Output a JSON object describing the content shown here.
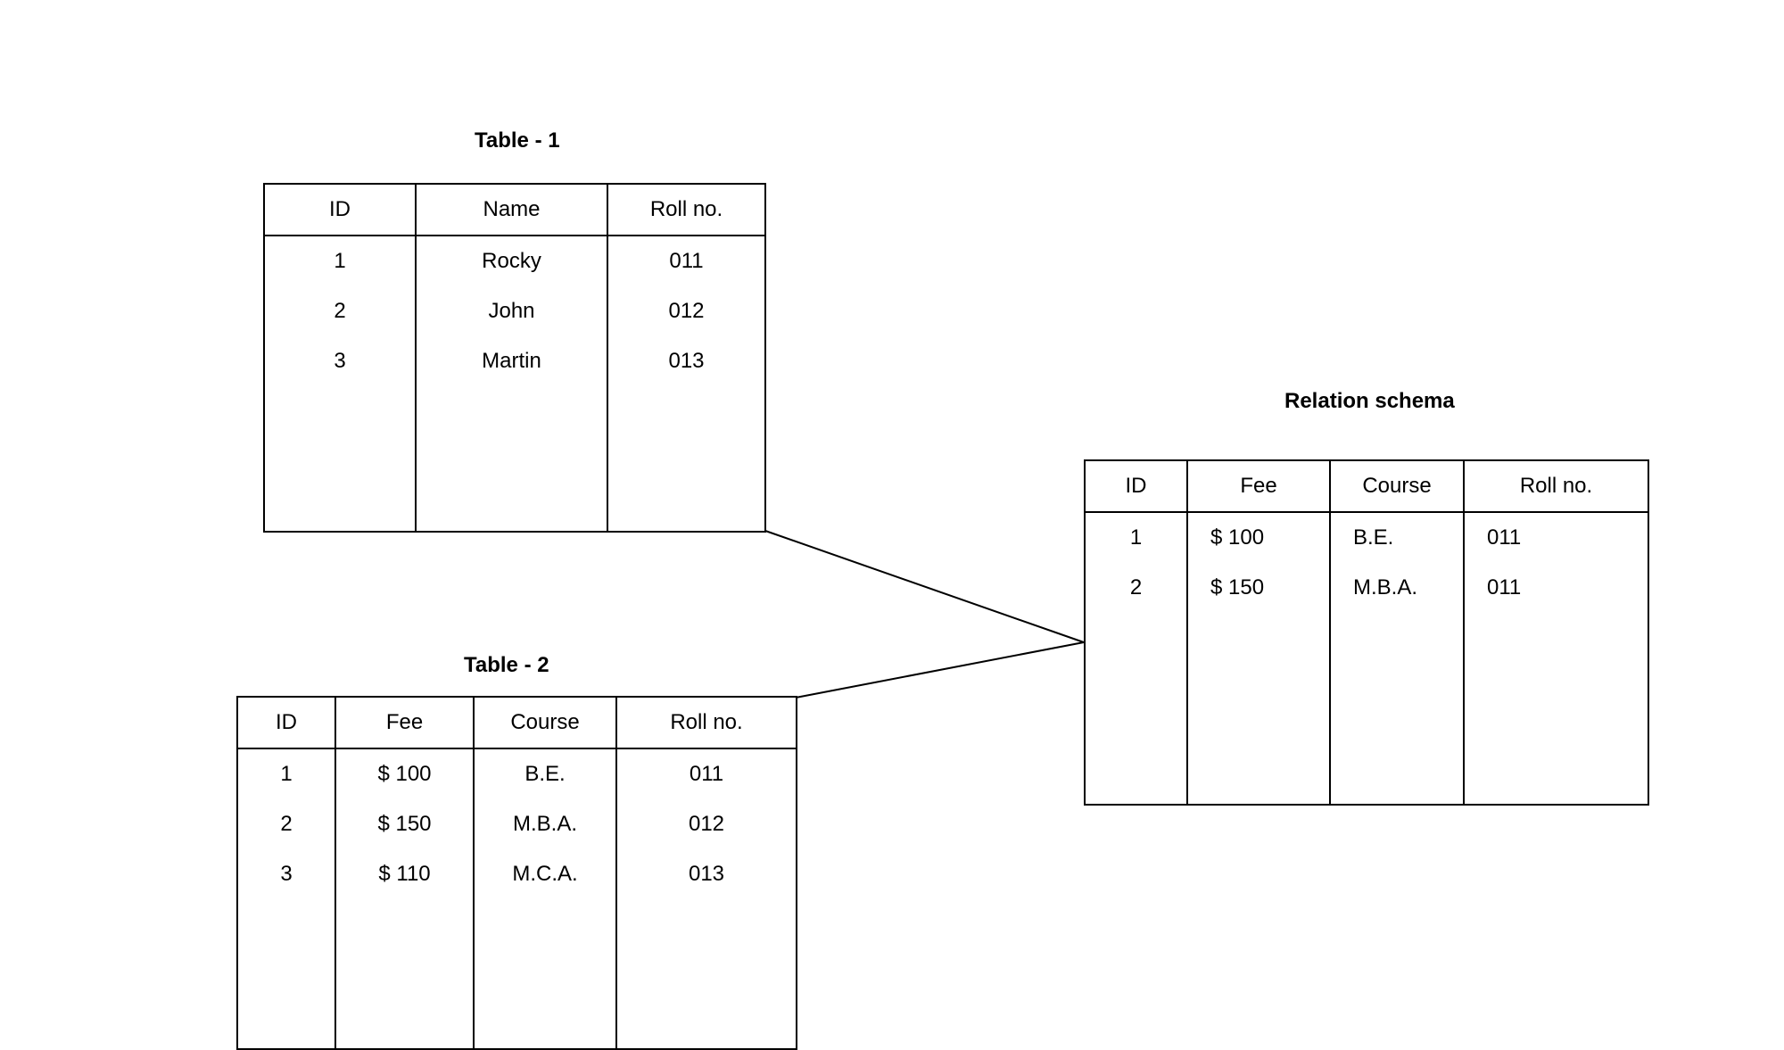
{
  "table1": {
    "title": "Table - 1",
    "headers": [
      "ID",
      "Name",
      "Roll no."
    ],
    "rows": [
      [
        "1",
        "Rocky",
        "011"
      ],
      [
        "2",
        "John",
        "012"
      ],
      [
        "3",
        "Martin",
        "013"
      ]
    ]
  },
  "table2": {
    "title": "Table - 2",
    "headers": [
      "ID",
      "Fee",
      "Course",
      "Roll no."
    ],
    "rows": [
      [
        "1",
        "$ 100",
        "B.E.",
        "011"
      ],
      [
        "2",
        "$ 150",
        "M.B.A.",
        "012"
      ],
      [
        "3",
        "$ 110",
        "M.C.A.",
        "013"
      ]
    ]
  },
  "table3": {
    "title": "Relation schema",
    "headers": [
      "ID",
      "Fee",
      "Course",
      "Roll no."
    ],
    "rows": [
      [
        "1",
        "$ 100",
        "B.E.",
        "011"
      ],
      [
        "2",
        "$ 150",
        "M.B.A.",
        "011"
      ]
    ]
  },
  "chart_data": {
    "type": "table",
    "description": "Diagram showing two source tables (Table-1 and Table-2) combining into a Relation schema table",
    "tables": [
      {
        "name": "Table - 1",
        "columns": [
          "ID",
          "Name",
          "Roll no."
        ],
        "data": [
          {
            "ID": "1",
            "Name": "Rocky",
            "Roll no.": "011"
          },
          {
            "ID": "2",
            "Name": "John",
            "Roll no.": "012"
          },
          {
            "ID": "3",
            "Name": "Martin",
            "Roll no.": "013"
          }
        ]
      },
      {
        "name": "Table - 2",
        "columns": [
          "ID",
          "Fee",
          "Course",
          "Roll no."
        ],
        "data": [
          {
            "ID": "1",
            "Fee": "$ 100",
            "Course": "B.E.",
            "Roll no.": "011"
          },
          {
            "ID": "2",
            "Fee": "$ 150",
            "Course": "M.B.A.",
            "Roll no.": "012"
          },
          {
            "ID": "3",
            "Fee": "$ 110",
            "Course": "M.C.A.",
            "Roll no.": "013"
          }
        ]
      },
      {
        "name": "Relation schema",
        "columns": [
          "ID",
          "Fee",
          "Course",
          "Roll no."
        ],
        "data": [
          {
            "ID": "1",
            "Fee": "$ 100",
            "Course": "B.E.",
            "Roll no.": "011"
          },
          {
            "ID": "2",
            "Fee": "$ 150",
            "Course": "M.B.A.",
            "Roll no.": "011"
          }
        ]
      }
    ],
    "relationships": [
      {
        "from": "Table - 1",
        "to": "Relation schema"
      },
      {
        "from": "Table - 2",
        "to": "Relation schema"
      }
    ]
  }
}
